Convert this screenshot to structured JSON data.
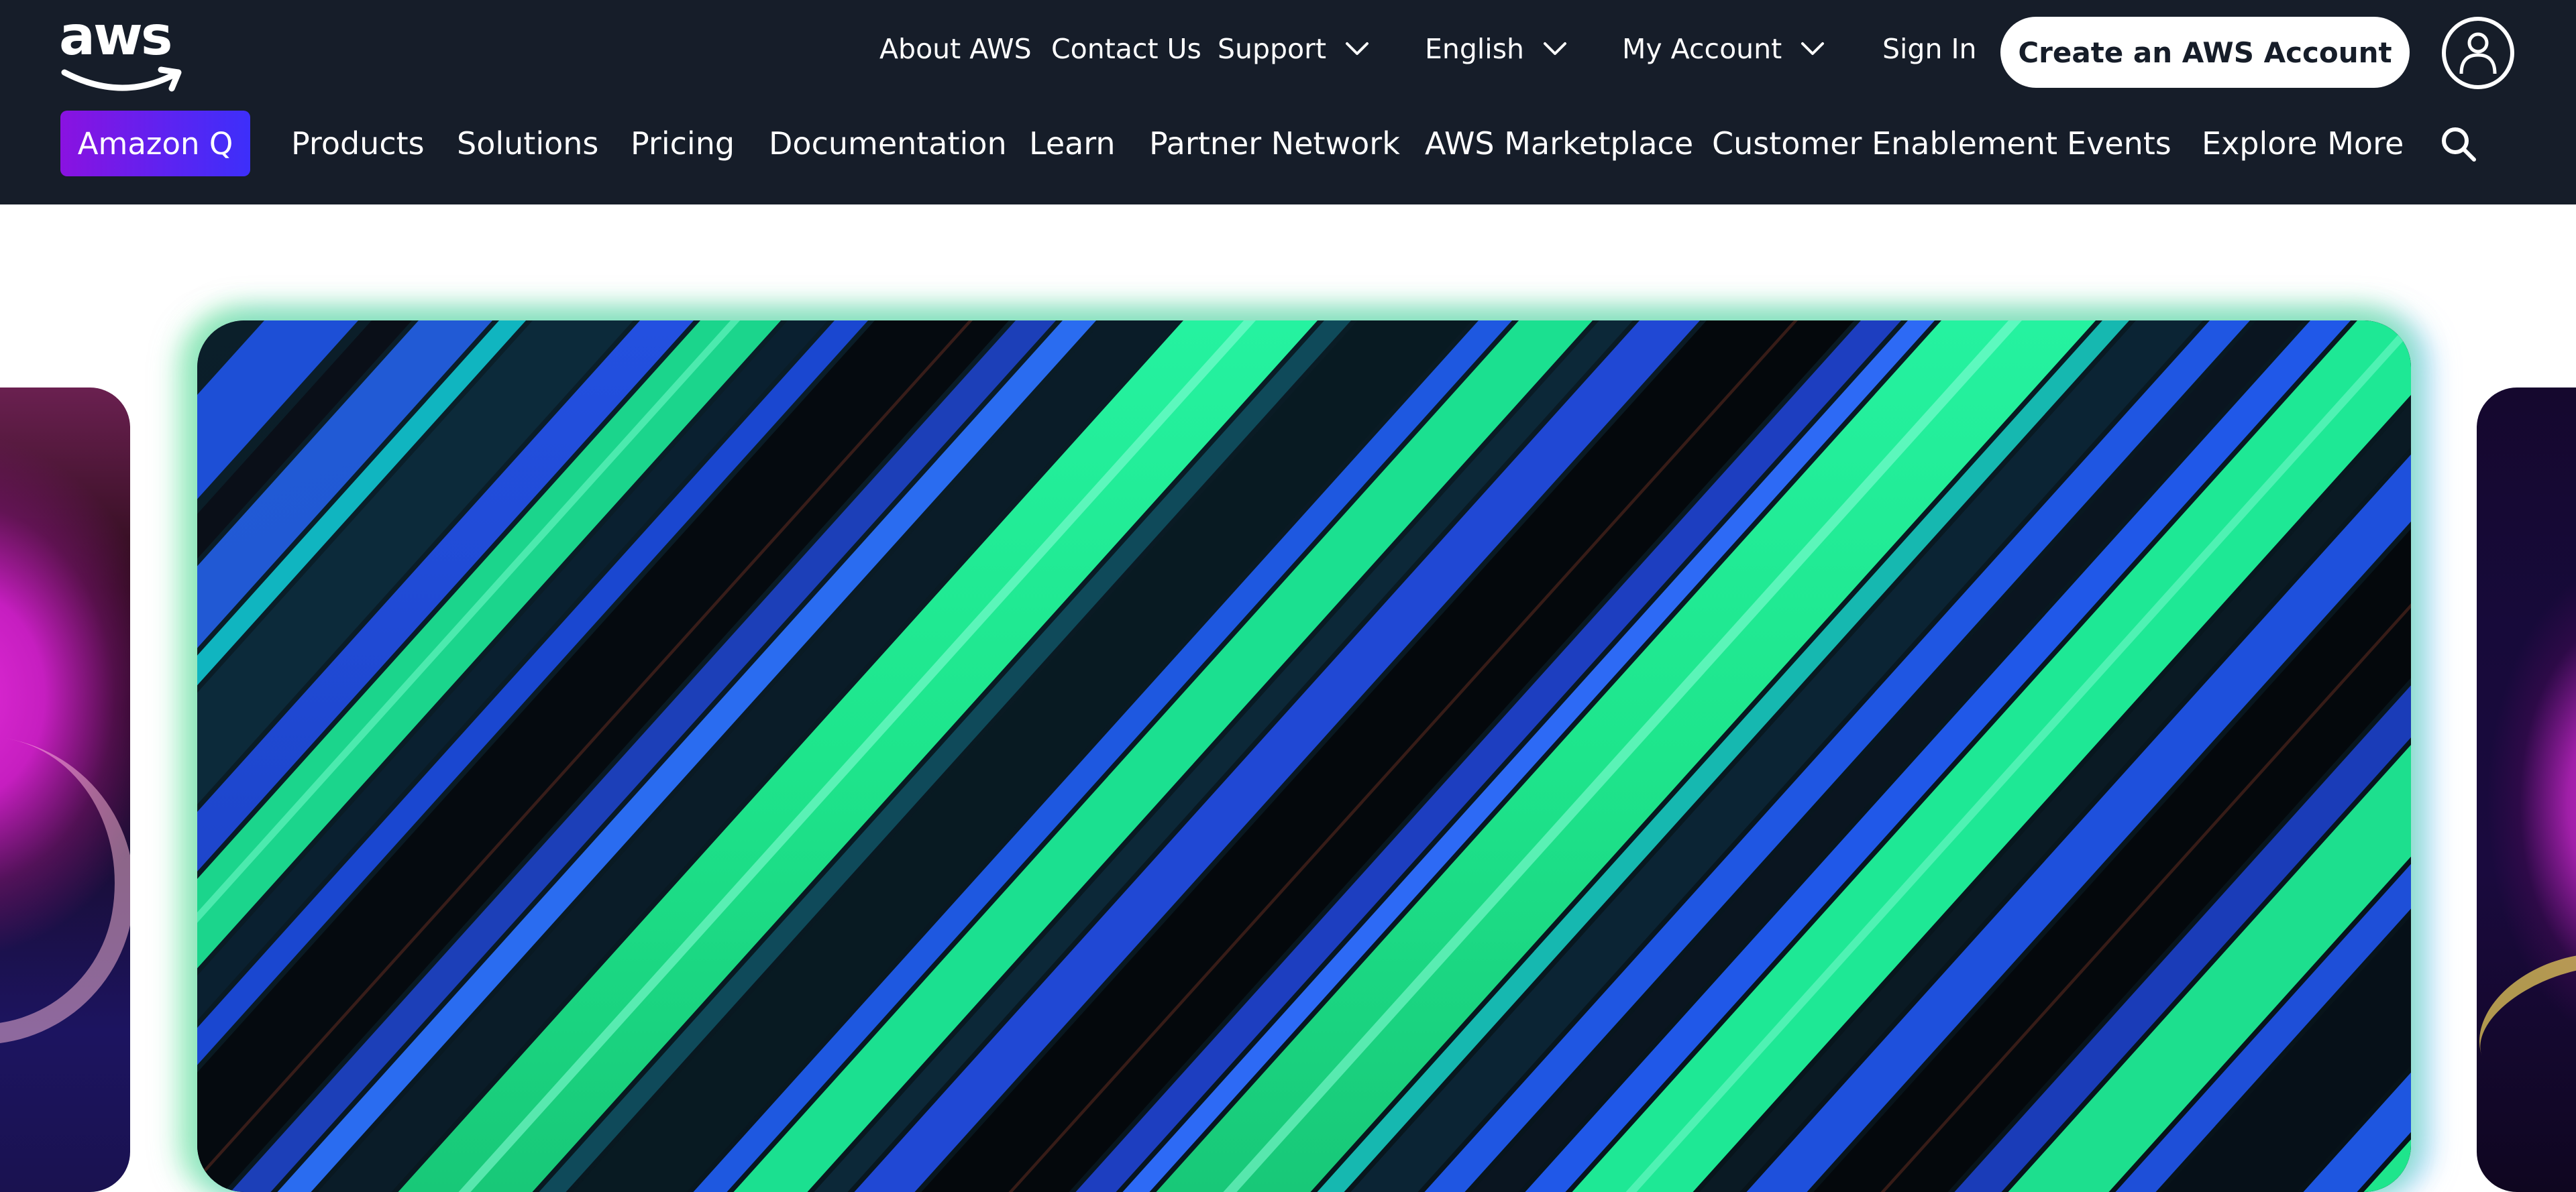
{
  "header": {
    "logo_text": "aws",
    "top_links": {
      "about": "About AWS",
      "contact": "Contact Us",
      "support": "Support",
      "language": "English",
      "account": "My Account",
      "sign_in": "Sign In"
    },
    "cta_label": "Create an AWS Account",
    "amazon_q_label": "Amazon Q",
    "main_nav": [
      "Products",
      "Solutions",
      "Pricing",
      "Documentation",
      "Learn",
      "Partner Network",
      "AWS Marketplace",
      "Customer Enablement",
      "Events",
      "Explore More"
    ],
    "icons": {
      "dropdown": "chevron-down-icon",
      "profile": "user-icon",
      "search": "search-icon"
    }
  },
  "colors": {
    "header_bg": "#161d29",
    "amazon_q_gradient_start": "#8a12e0",
    "amazon_q_gradient_end": "#3d2ffa",
    "hero_green": "#1ee58c",
    "hero_blue": "#1e4fd8"
  }
}
